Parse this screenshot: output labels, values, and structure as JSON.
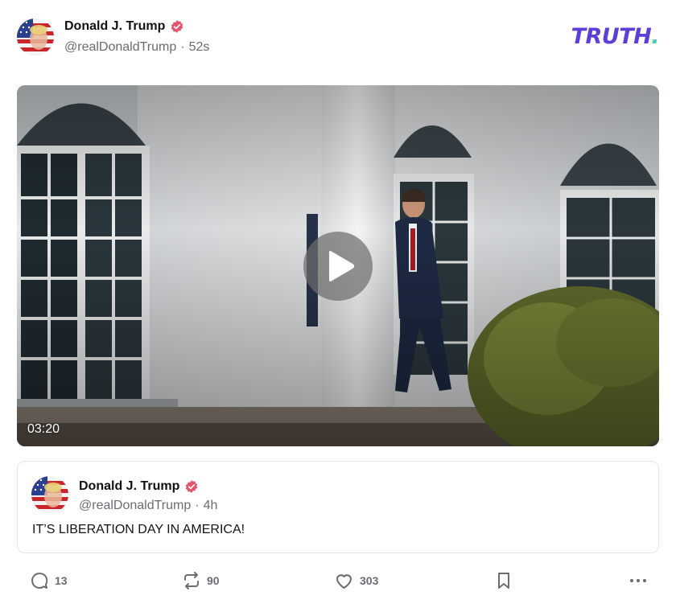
{
  "post": {
    "author": {
      "display_name": "Donald J. Trump",
      "handle": "@realDonaldTrump",
      "verified": true
    },
    "separator": "·",
    "time_ago": "52s",
    "brand": {
      "text": "TRUTH",
      "dot": "."
    },
    "video": {
      "duration": "03:20"
    },
    "quoted_post": {
      "author": {
        "display_name": "Donald J. Trump",
        "handle": "@realDonaldTrump",
        "verified": true
      },
      "time_ago": "4h",
      "text": "IT’S LIBERATION DAY IN AMERICA!"
    },
    "actions": {
      "replies": "13",
      "retruths": "90",
      "likes": "303"
    }
  },
  "colors": {
    "brand": "#5b3fd6",
    "brand_dot": "#3ed3b4",
    "verified": "#e5546a",
    "muted_text": "#6b6b72"
  },
  "icons": [
    "avatar-image",
    "verified-badge-icon",
    "play-icon",
    "reply-icon",
    "retruth-icon",
    "like-icon",
    "bookmark-icon",
    "more-icon"
  ]
}
